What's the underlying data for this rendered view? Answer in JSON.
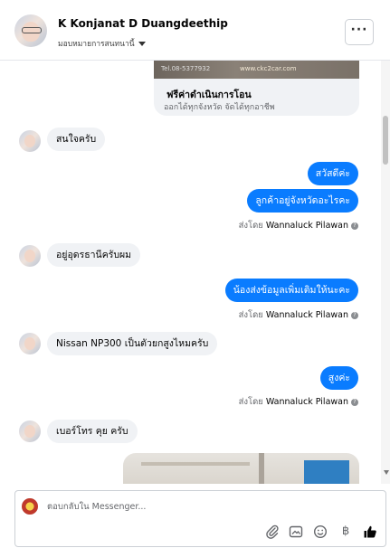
{
  "header": {
    "name": "K Konjanat D Duangdeethip",
    "subtitle": "มอบหมายการสนทนานี้",
    "more_label": "···"
  },
  "card": {
    "image_text_phone": "Tel.08-5377932",
    "image_text_url": "www.ckc2car.com",
    "title": "ฟรีค่าดำเนินการโอน",
    "subtitle": "ออกได้ทุกจังหวัด จัดได้ทุกอาชีพ"
  },
  "messages": [
    {
      "dir": "in",
      "text": "สนใจครับ"
    },
    {
      "dir": "out",
      "text": "สวัสดีค่ะ"
    },
    {
      "dir": "out",
      "text": "ลูกค้าอยู่จังหวัดอะไรคะ"
    },
    {
      "dir": "in",
      "text": "อยู่อุดรธานีครับผม"
    },
    {
      "dir": "out",
      "text": "น้องส่งข้อมูลเพิ่มเติมให้นะคะ"
    },
    {
      "dir": "in",
      "text": "Nissan NP300 เป็นตัวยกสูงไหมครับ"
    },
    {
      "dir": "out",
      "text": "สูงค่ะ"
    },
    {
      "dir": "in",
      "text": "เบอร์โทร คุย ครับ"
    }
  ],
  "sent_by": {
    "label": "ส่งโดย",
    "name": "Wannaluck Pilawan",
    "help_icon": "?"
  },
  "composer": {
    "placeholder": "ตอบกลับใน Messenger...",
    "icons": [
      "attachment-icon",
      "gif-icon",
      "emoji-icon",
      "settings-icon",
      "baht-icon",
      "like-icon"
    ],
    "baht_glyph": "฿"
  },
  "colors": {
    "outgoing_bubble": "#0a7cff",
    "incoming_bubble": "#f0f2f5",
    "muted_text": "#65676b"
  }
}
